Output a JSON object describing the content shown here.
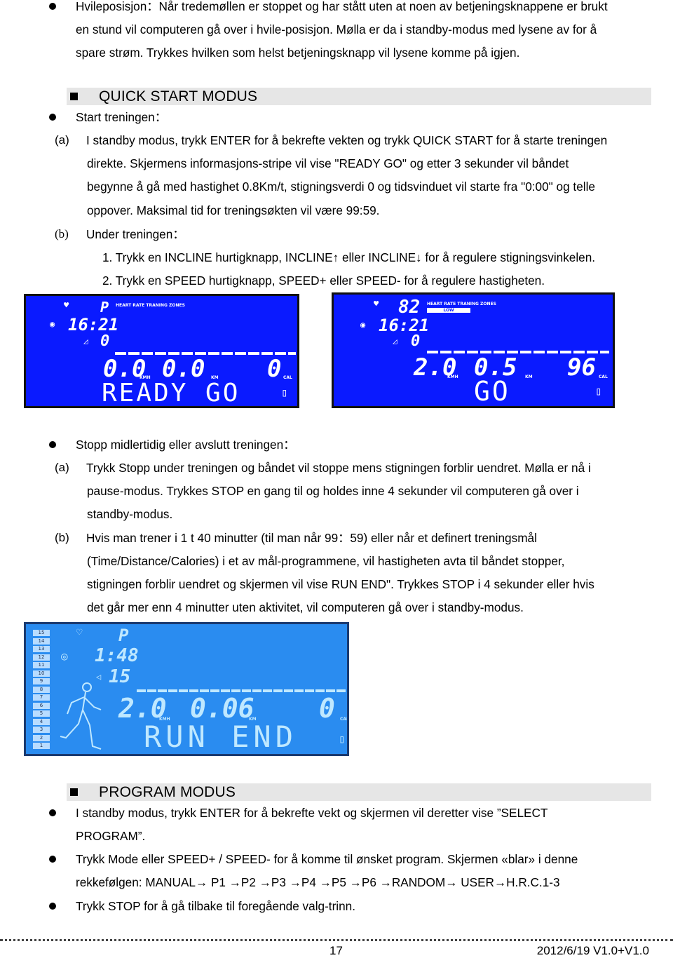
{
  "standby": {
    "lines": [
      "Hvileposisjon：Når tredemøllen er stoppet og har stått uten at noen av betjeningsknappene er brukt",
      "en stund vil computeren gå over i hvile-posisjon. Mølla er da i standby-modus med lysene av for å",
      "spare strøm. Trykkes hvilken som helst betjeningsknapp vil lysene komme på igjen."
    ]
  },
  "quick_start": {
    "title": "QUICK START MODUS",
    "bullet": "Start treningen：",
    "a_label": "(a)",
    "a_lines": [
      "I standby modus, trykk ENTER for å bekrefte vekten og trykk QUICK START for å starte treningen",
      "direkte. Skjermens informasjons-stripe vil vise \"READY GO\" og etter 3 sekunder vil båndet",
      "begynne å gå med hastighet 0.8Km/t, stigningsverdi 0 og tidsvinduet vil starte fra \"0:00\" og telle",
      "oppover. Maksimal tid for treningsøkten vil være 99:59."
    ],
    "b_label": "(b)",
    "b_text": "Under treningen：",
    "items": [
      "1. Trykk en INCLINE hurtigknapp, INCLINE↑  eller INCLINE↓  for å regulere stigningsvinkelen.",
      "2. Trykk en SPEED hurtigknapp, SPEED+ eller SPEED- for å regulere hastigheten."
    ]
  },
  "lcd1": {
    "program": "P",
    "header": "HEART RATE TRANING ZONES",
    "time": "16:21",
    "incline": "0",
    "speed": "0.0",
    "speed_unit": "KMH",
    "distance": "0.0",
    "distance_unit": "KM",
    "calories": "0",
    "calories_unit": "CAL",
    "message": "READY GO"
  },
  "lcd2": {
    "pulse": "82",
    "header": "HEART RATE TRANING ZONES",
    "zone": "LOW",
    "time": "16:21",
    "incline": "0",
    "speed": "2.0",
    "speed_unit": "KMH",
    "distance": "0.5",
    "distance_unit": "KM",
    "calories": "96",
    "calories_unit": "CAL",
    "message": "GO"
  },
  "stop": {
    "bullet": "Stopp midlertidig eller avslutt treningen：",
    "a_label": "(a)",
    "a_lines": [
      "Trykk Stopp under treningen og båndet vil stoppe mens stigningen forblir uendret. Mølla er nå i",
      "pause-modus. Trykkes STOP en gang til og holdes inne 4 sekunder vil computeren gå over i",
      "standby-modus."
    ],
    "b_label": "(b)",
    "b_lines": [
      "Hvis man trener i 1 t 40 minutter (til man når 99：59) eller når et definert treningsmål",
      "(Time/Distance/Calories) i et av mål-programmene, vil hastigheten avta til båndet stopper,",
      "stigningen forblir uendret og skjermen vil vise RUN END\". Trykkes STOP i 4 sekunder eller hvis",
      "det går mer enn 4 minutter uten aktivitet, vil computeren gå over i standby-modus."
    ]
  },
  "lcd3": {
    "levels": [
      "15",
      "14",
      "13",
      "12",
      "11",
      "10",
      "9",
      "8",
      "7",
      "6",
      "5",
      "4",
      "3",
      "2",
      "1"
    ],
    "program": "P",
    "time": "1:48",
    "incline": "15",
    "speed": "2.0",
    "speed_unit": "KMH",
    "distance": "0.06",
    "distance_unit": "KM",
    "calories": "0",
    "calories_unit": "CAL",
    "message": "RUN END"
  },
  "program": {
    "title": "PROGRAM MODUS",
    "bullets": [
      [
        "I standby modus, trykk ENTER for å bekrefte vekt og skjermen vil deretter vise ”SELECT",
        "PROGRAM”."
      ],
      [
        "Trykk Mode eller SPEED+ / SPEED- for å komme til ønsket program. Skjermen «blar» i denne",
        "rekkefølgen: MANUAL→ P1 →P2 →P3 →P4 →P5 →P6 →RANDOM→ USER→H.R.C.1-3"
      ],
      [
        "Trykk STOP for å gå tilbake til foregående valg-trinn."
      ]
    ]
  },
  "footer": {
    "page": "17",
    "version": "2012/6/19 V1.0+V1.0"
  }
}
